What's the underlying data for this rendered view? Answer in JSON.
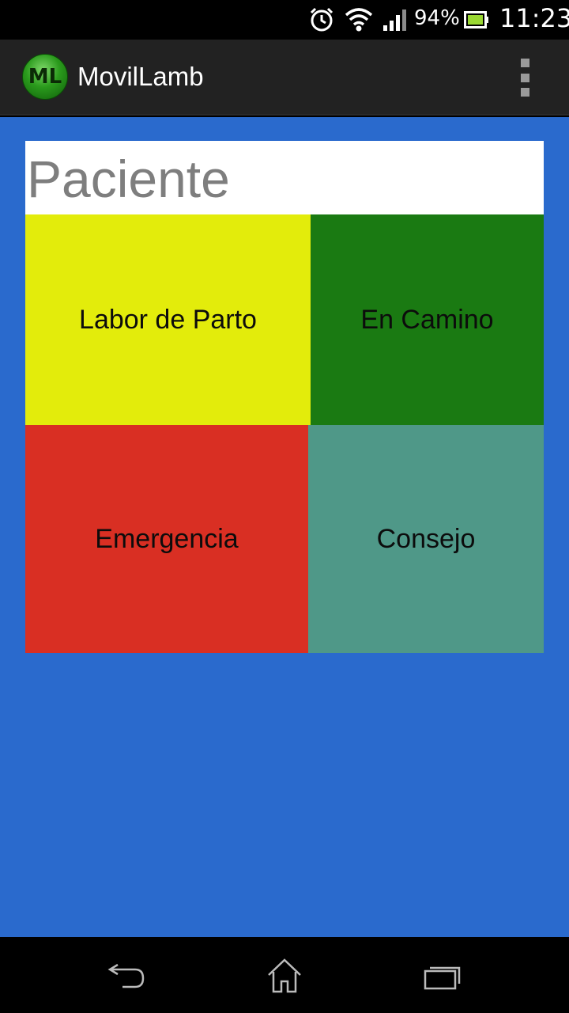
{
  "status_bar": {
    "battery_percent": "94%",
    "time": "11:23",
    "icons": [
      "alarm-icon",
      "wifi-icon",
      "signal-icon",
      "battery-icon"
    ]
  },
  "action_bar": {
    "logo_text": "ML",
    "title": "MovilLamb",
    "overflow_icon": "overflow-menu-icon"
  },
  "card": {
    "title": "Paciente",
    "tiles": [
      {
        "label": "Labor de Parto",
        "color": "#e3ec0b"
      },
      {
        "label": "En Camino",
        "color": "#1a7a12"
      },
      {
        "label": "Emergencia",
        "color": "#d92f23"
      },
      {
        "label": "Consejo",
        "color": "#4f9888"
      }
    ]
  },
  "colors": {
    "background": "#2a6acd",
    "action_bar": "#222222",
    "title_text": "#7e7e7e"
  },
  "nav_bar": {
    "buttons": [
      "back-icon",
      "home-icon",
      "recent-apps-icon"
    ]
  }
}
